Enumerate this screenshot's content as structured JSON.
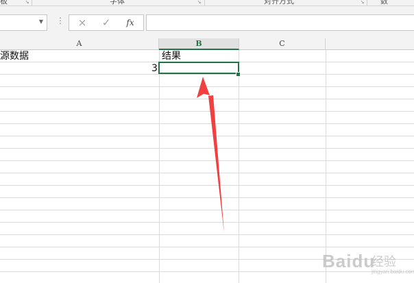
{
  "ribbon": {
    "groups": [
      "板",
      "字体",
      "对齐方式",
      "数"
    ]
  },
  "formula_bar": {
    "name_box_value": "",
    "cancel_icon": "×",
    "enter_icon": "✓",
    "fx_label": "fx",
    "formula_value": ""
  },
  "columns": [
    "A",
    "B",
    "C"
  ],
  "active_column": "B",
  "cells": {
    "A1": "源数据",
    "B1": "结果",
    "A2": "3",
    "B2": ""
  },
  "selected_cell": "B2",
  "annotation": {
    "arrow_color": "#f04040"
  },
  "watermark": {
    "brand": "Baidu",
    "cn": "经验",
    "sub": "jingyan.baidu.com"
  }
}
